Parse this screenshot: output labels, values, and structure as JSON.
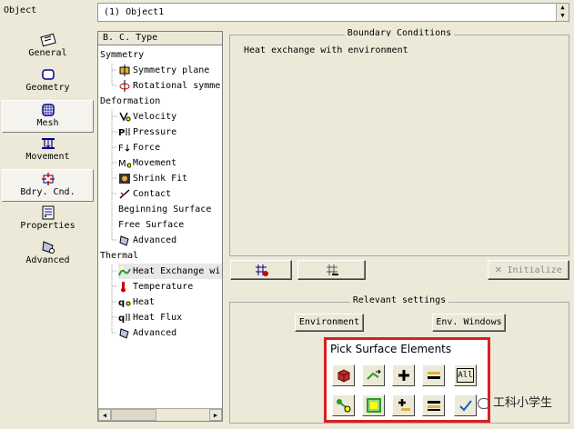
{
  "object": {
    "label": "Object",
    "value": "(1) Object1"
  },
  "nav": {
    "items": [
      {
        "label": "General",
        "selected": false
      },
      {
        "label": "Geometry",
        "selected": false
      },
      {
        "label": "Mesh",
        "selected": true
      },
      {
        "label": "Movement",
        "selected": false
      },
      {
        "label": "Bdry. Cnd.",
        "selected": true
      },
      {
        "label": "Properties",
        "selected": false
      },
      {
        "label": "Advanced",
        "selected": false
      }
    ]
  },
  "tree": {
    "header": "B. C. Type",
    "rows": [
      {
        "text": "Symmetry",
        "kind": "group"
      },
      {
        "text": "Symmetry plane",
        "kind": "item"
      },
      {
        "text": "Rotational symme",
        "kind": "item"
      },
      {
        "text": "Deformation",
        "kind": "group"
      },
      {
        "text": "Velocity",
        "kind": "item"
      },
      {
        "text": "Pressure",
        "kind": "item"
      },
      {
        "text": "Force",
        "kind": "item"
      },
      {
        "text": "Movement",
        "kind": "item"
      },
      {
        "text": "Shrink Fit",
        "kind": "item"
      },
      {
        "text": "Contact",
        "kind": "item"
      },
      {
        "text": "Beginning Surface",
        "kind": "plain"
      },
      {
        "text": "Free Surface",
        "kind": "plain"
      },
      {
        "text": "Advanced",
        "kind": "item"
      },
      {
        "text": "Thermal",
        "kind": "group"
      },
      {
        "text": "Heat Exchange wi",
        "kind": "item"
      },
      {
        "text": "Temperature",
        "kind": "item"
      },
      {
        "text": "Heat",
        "kind": "item"
      },
      {
        "text": "Heat Flux",
        "kind": "item"
      },
      {
        "text": "Advanced",
        "kind": "item"
      }
    ]
  },
  "boundary": {
    "title": "Boundary Conditions",
    "entries": [
      "Heat exchange with environment"
    ],
    "initialize_label": "Initialize"
  },
  "relevant": {
    "title": "Relevant settings",
    "environment_label": "Environment",
    "env_windows_label": "Env. Windows"
  },
  "pick": {
    "title": "Pick Surface Elements",
    "all_label": "All"
  },
  "watermark": {
    "text": "工科小学生"
  },
  "colors": {
    "highlight": "#d92020",
    "face": "#ece9d8"
  }
}
